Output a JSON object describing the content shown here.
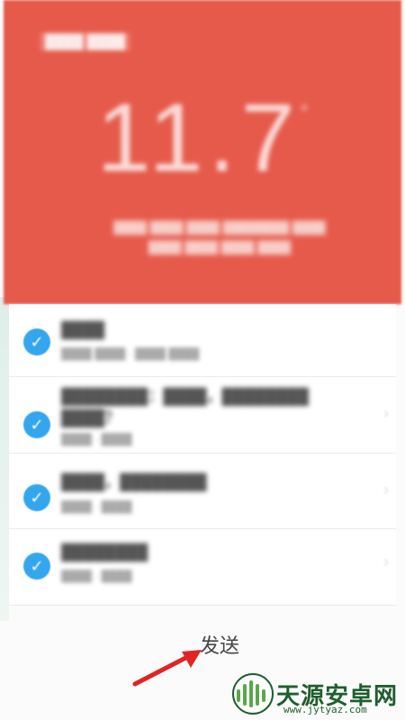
{
  "hero": {
    "title": "████ ████",
    "value": "11.7",
    "unit": "°",
    "caption_line1": "████ ████ ████ ████████ ████",
    "caption_line2": "████ ████ ████ ████"
  },
  "items": [
    {
      "title": "████",
      "meta": "████ ████  ·  ████ ████"
    },
    {
      "title": "████████：████，████████ ████？",
      "meta": "████  ·  ████"
    },
    {
      "title": "████，████████",
      "meta": "████  ·  ████"
    },
    {
      "title": "████████",
      "meta": "████  ·  ████"
    }
  ],
  "send": {
    "label": "发送"
  },
  "watermark": {
    "brand": "天源安卓网",
    "url": "www.jytyaz.com"
  },
  "colors": {
    "hero_bg": "#e65a4b",
    "check": "#33a6ee",
    "arrow": "#e02424",
    "watermark": "#1f5e2d"
  }
}
